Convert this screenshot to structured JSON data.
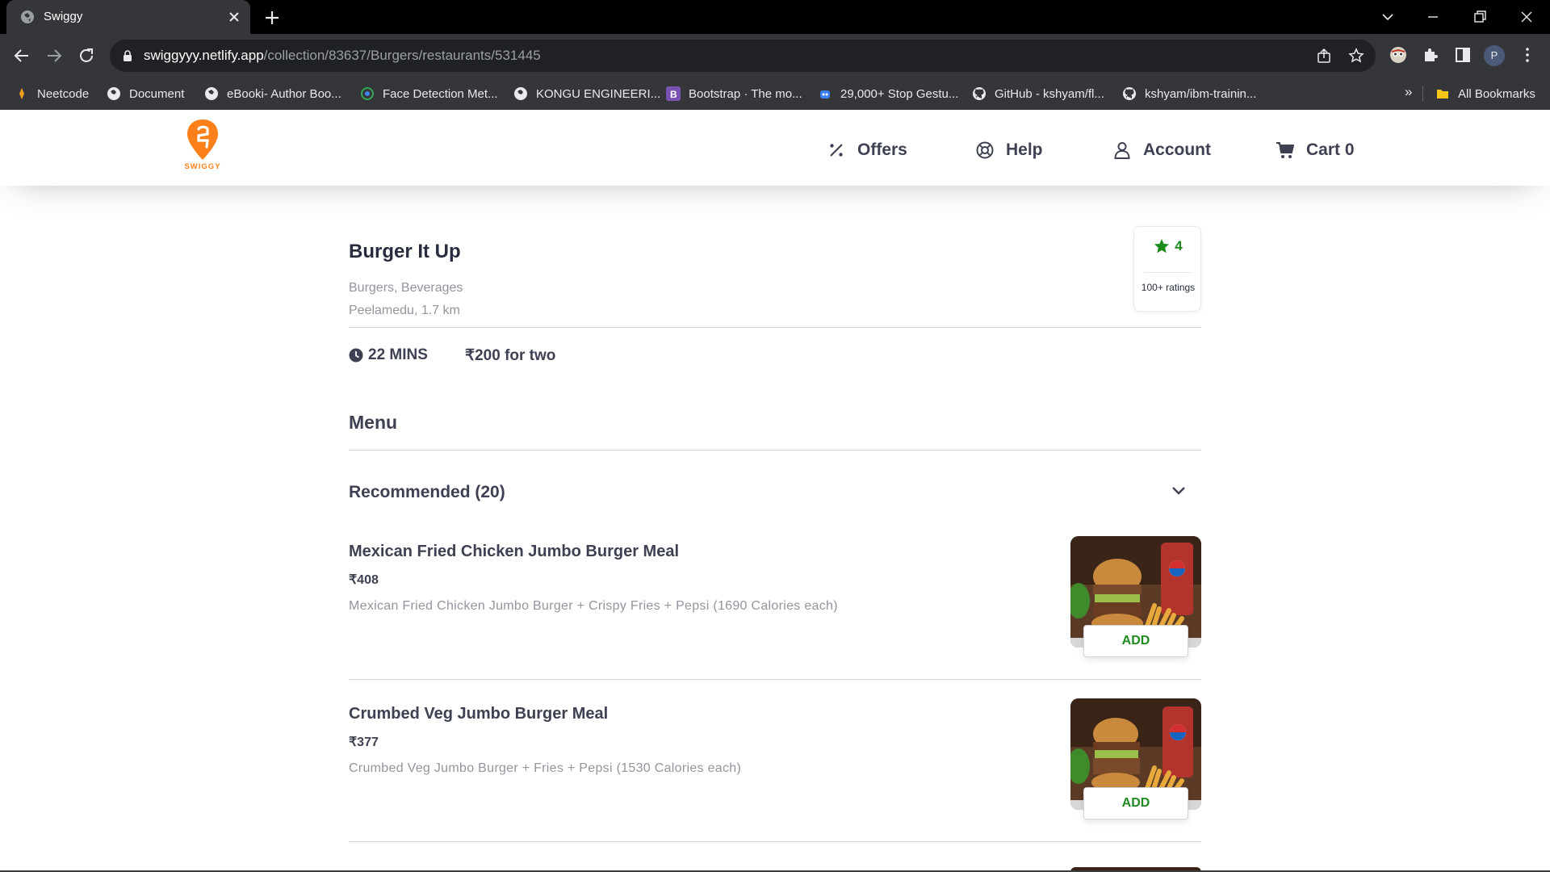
{
  "browser": {
    "tab_title": "Swiggy",
    "url_host": "swiggyyy.netlify.app",
    "url_path": "/collection/83637/Burgers/restaurants/531445",
    "profile_initial": "P",
    "bookmarks": [
      {
        "label": "Neetcode",
        "icon": "neetcode-icon"
      },
      {
        "label": "Document",
        "icon": "globe-icon"
      },
      {
        "label": "eBooki- Author Boo...",
        "icon": "globe-icon"
      },
      {
        "label": "Face Detection Met...",
        "icon": "face-detection-icon"
      },
      {
        "label": "KONGU ENGINEERI...",
        "icon": "globe-icon"
      },
      {
        "label": "Bootstrap · The mo...",
        "icon": "bootstrap-icon"
      },
      {
        "label": "29,000+ Stop Gestu...",
        "icon": "robot-icon"
      },
      {
        "label": "GitHub - kshyam/fl...",
        "icon": "github-icon"
      },
      {
        "label": "kshyam/ibm-trainin...",
        "icon": "github-icon"
      }
    ],
    "bookmarks_more": "»",
    "all_bookmarks": "All Bookmarks"
  },
  "header": {
    "logo_text": "SWIGGY",
    "nav": {
      "offers": "Offers",
      "help": "Help",
      "account": "Account",
      "cart": "Cart 0"
    }
  },
  "restaurant": {
    "name": "Burger It Up",
    "cuisines": "Burgers, Beverages",
    "area": "Peelamedu, 1.7 km",
    "rating": "4",
    "rating_count": "100+ ratings",
    "delivery_time": "22 MINS",
    "cost_for_two": "₹200 for two"
  },
  "menu": {
    "heading": "Menu",
    "section_title": "Recommended (20)",
    "items": [
      {
        "name": "Mexican Fried Chicken Jumbo Burger Meal",
        "price": "₹408",
        "description": "Mexican Fried Chicken Jumbo Burger + Crispy Fries + Pepsi (1690 Calories each)",
        "add_label": "ADD"
      },
      {
        "name": "Crumbed Veg Jumbo Burger Meal",
        "price": "₹377",
        "description": "Crumbed Veg Jumbo Burger + Fries + Pepsi (1530 Calories each)",
        "add_label": "ADD"
      }
    ]
  },
  "colors": {
    "brand_orange": "#fc8019",
    "rating_green": "#1a8a1a",
    "add_green": "#1f8a1f",
    "text_dark": "#3e4152",
    "text_muted": "#93959f"
  }
}
